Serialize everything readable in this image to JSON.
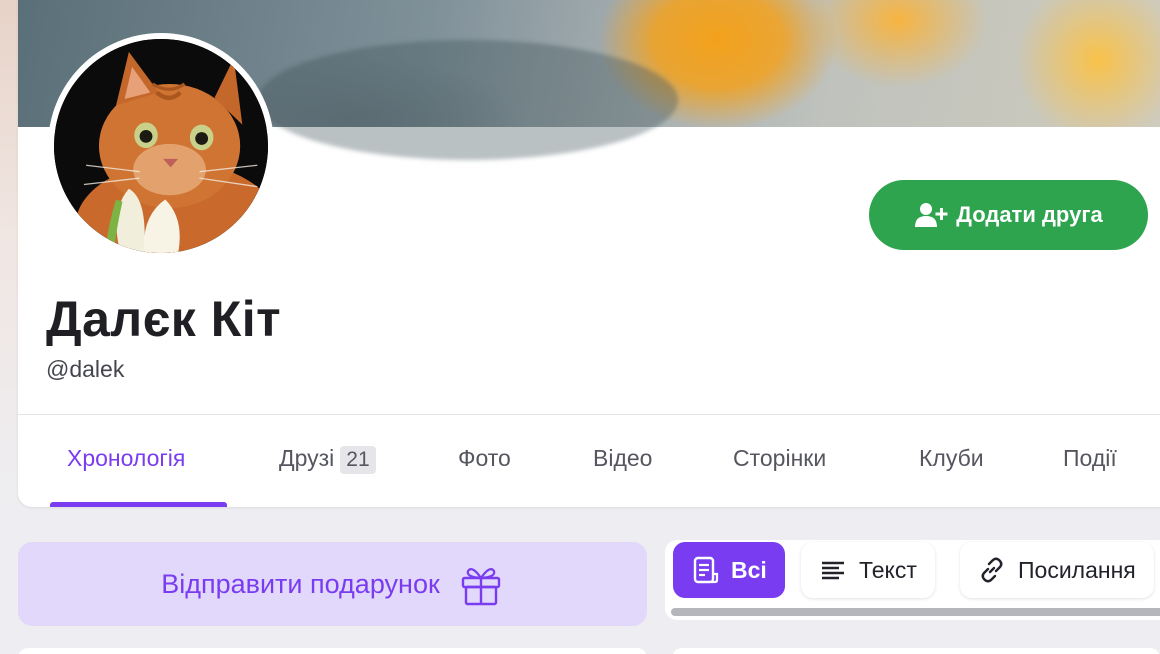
{
  "profile": {
    "name": "Далєк Кіт",
    "handle": "@dalek",
    "add_friend_label": "Додати друга"
  },
  "tabs": [
    {
      "label": "Хронологія",
      "active": true
    },
    {
      "label": "Друзі",
      "count": "21"
    },
    {
      "label": "Фото"
    },
    {
      "label": "Відео"
    },
    {
      "label": "Сторінки"
    },
    {
      "label": "Клуби"
    },
    {
      "label": "Події"
    }
  ],
  "gift": {
    "label": "Відправити подарунок"
  },
  "filters": [
    {
      "label": "Всі",
      "icon": "document-icon",
      "active": true
    },
    {
      "label": "Текст",
      "icon": "text-lines-icon"
    },
    {
      "label": "Посилання",
      "icon": "link-icon"
    }
  ],
  "colors": {
    "accent": "#7a3cf0",
    "add_friend": "#2ea44f",
    "gift_bg": "#e1d8fb"
  }
}
